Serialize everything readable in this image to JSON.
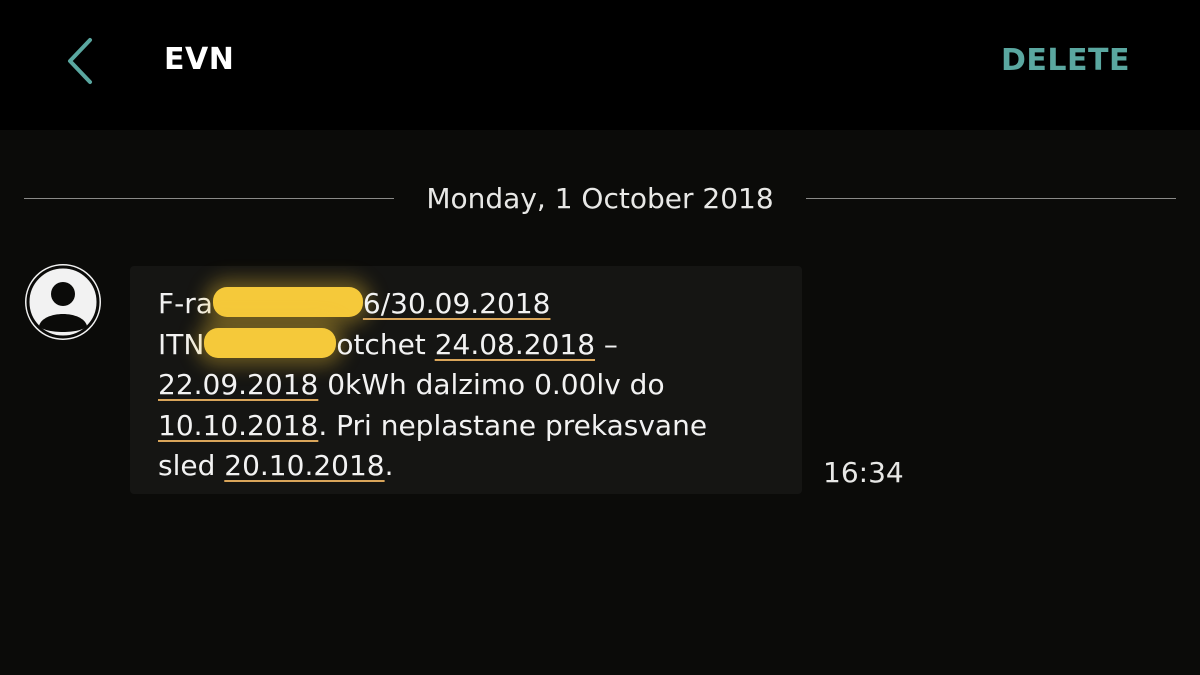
{
  "header": {
    "title": "EVN",
    "delete_label": "DELETE",
    "back_icon": "chevron-left-icon"
  },
  "conversation": {
    "date_label": "Monday, 1 October 2018",
    "avatar_icon": "person-icon",
    "message": {
      "line1": {
        "prefix": "F-ra",
        "suffix": "6/30.09.2018"
      },
      "line2": {
        "prefix": "ITN",
        "suffix": "otchet",
        "date": "24.08.2018",
        "tail": " –"
      },
      "line3": {
        "date": "22.09.2018",
        "text": " 0kWh dalzimo 0.00lv do"
      },
      "line4": {
        "date": "10.10.2018",
        "text": ". Pri neplastane prekasvane"
      },
      "line5": {
        "prefix": "sled ",
        "date": "20.10.2018",
        "tail": "."
      }
    },
    "time": "16:34"
  },
  "colors": {
    "background": "#0b0b09",
    "topbar": "#000000",
    "accent": "#5aa7a0",
    "bubble": "#151513",
    "link_underline": "#d9a55a",
    "redaction": "#f5c93a"
  }
}
